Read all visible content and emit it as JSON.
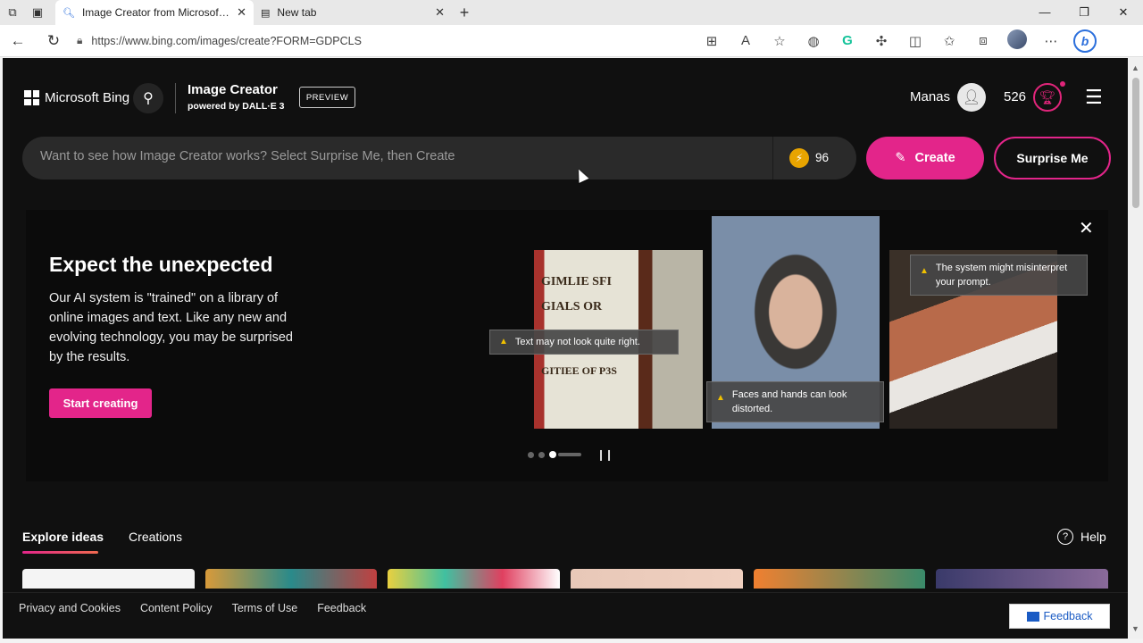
{
  "browser": {
    "tabs": [
      {
        "title": "Image Creator from Microsoft Bing",
        "active": true
      },
      {
        "title": "New tab",
        "active": false
      }
    ],
    "url": "https://www.bing.com/images/create?FORM=GDPCLS"
  },
  "header": {
    "brand": "Microsoft Bing",
    "product_title": "Image Creator",
    "product_subtitle": "powered by DALL·E 3",
    "preview_badge": "PREVIEW",
    "user_name": "Manas",
    "reward_points": "526"
  },
  "prompt": {
    "placeholder": "Want to see how Image Creator works? Select Surprise Me, then Create",
    "boosts": "96",
    "create_label": "Create",
    "surprise_label": "Surprise Me"
  },
  "promo": {
    "title": "Expect the unexpected",
    "body": "Our AI system is \"trained\" on a library of online images and text. Like any new and evolving technology, you may be surprised by the results.",
    "cta": "Start creating",
    "tips": [
      "Text may not look quite right.",
      "Faces and hands can look distorted.",
      "The system might misinterpret your prompt."
    ],
    "gas_lines": [
      "GIMLIE SFI",
      "GIALS OR",
      "GITIEE OF P3S"
    ]
  },
  "tabs": {
    "explore": "Explore ideas",
    "creations": "Creations",
    "help": "Help"
  },
  "footer": {
    "links": [
      "Privacy and Cookies",
      "Content Policy",
      "Terms of Use",
      "Feedback"
    ],
    "feedback_button": "Feedback"
  },
  "colors": {
    "accent": "#e3258a",
    "page_bg": "#101010"
  }
}
